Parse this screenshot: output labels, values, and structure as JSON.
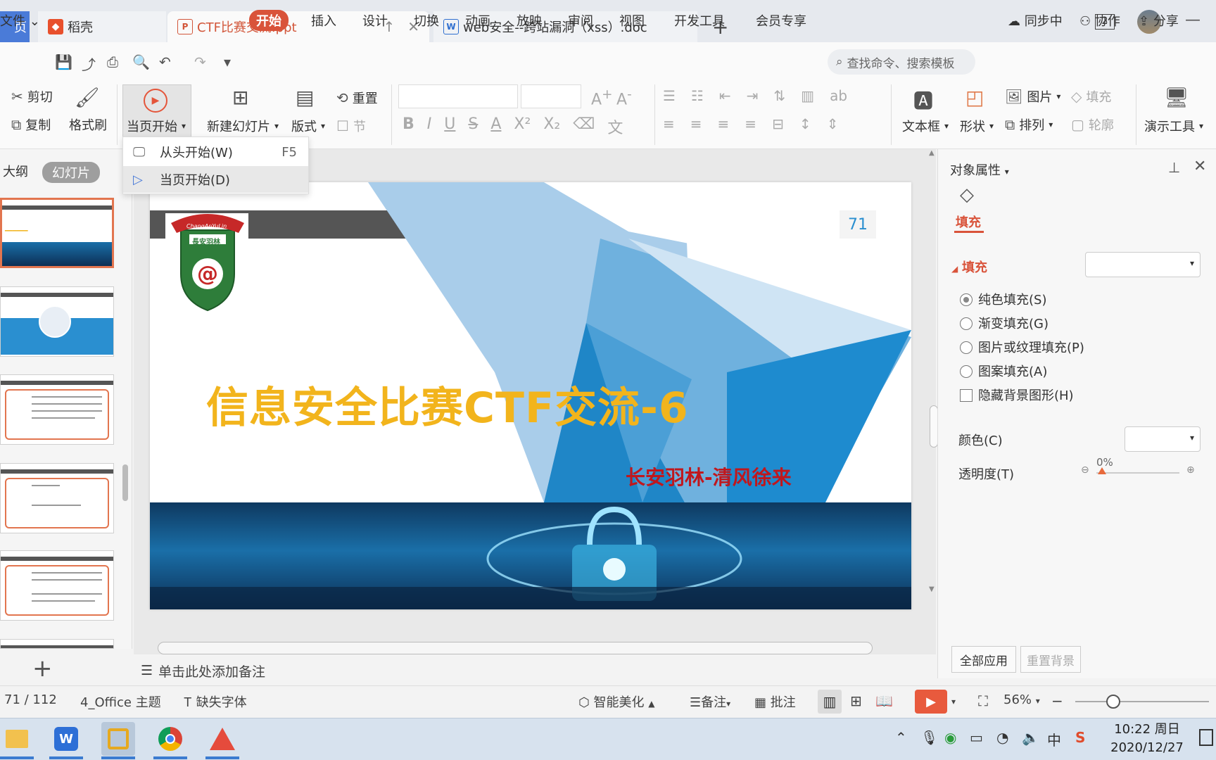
{
  "tabs": {
    "home_label": "页",
    "daoke": "稻壳",
    "active_file": "CTF比赛交流.ppt",
    "doc_file": "web安全--跨站漏洞（xss）.doc",
    "add": "+",
    "window_count": "2"
  },
  "menu": {
    "file": "文件",
    "items": [
      "开始",
      "插入",
      "设计",
      "切换",
      "动画",
      "放映",
      "审阅",
      "视图",
      "开发工具",
      "会员专享"
    ],
    "search_placeholder": "查找命令、搜索模板",
    "sync": "同步中",
    "collab": "协作",
    "share": "分享"
  },
  "ribbon": {
    "cut": "剪切",
    "copy": "复制",
    "format_painter": "格式刷",
    "from_current": "当页开始",
    "new_slide": "新建幻灯片",
    "layout": "版式",
    "reset": "重置",
    "section": "节",
    "textbox": "文本框",
    "shape": "形状",
    "picture": "图片",
    "arrange": "排列",
    "fill": "填充",
    "outline": "轮廓",
    "presenter_tools": "演示工具"
  },
  "dropdown": {
    "from_start": "从头开始(W)",
    "from_start_key": "F5",
    "from_current": "当页开始(D)"
  },
  "left_panel": {
    "outline_tab": "大纲",
    "slides_tab": "幻灯片",
    "add_icon": "+"
  },
  "slide": {
    "number": "71",
    "title": "信息安全比赛CTF交流-6",
    "subtitle": "长安羽林-清风徐来",
    "logo_text": "ChangAnYuLin",
    "logo_cn": "長安羽林"
  },
  "notes_placeholder": "单击此处添加备注",
  "right_panel": {
    "title": "对象属性",
    "tab_fill": "填充",
    "section_fill": "填充",
    "options": [
      "纯色填充(S)",
      "渐变填充(G)",
      "图片或纹理填充(P)",
      "图案填充(A)"
    ],
    "selected_option": 0,
    "hide_bg": "隐藏背景图形(H)",
    "color_label": "颜色(C)",
    "transparency_label": "透明度(T)",
    "transparency_value": "0%",
    "apply_all": "全部应用",
    "reset_bg": "重置背景"
  },
  "status": {
    "slide_pos": "71 / 112",
    "theme": "4_Office 主题",
    "missing_font": "缺失字体",
    "beautify": "智能美化",
    "notes": "备注",
    "comments": "批注",
    "zoom": "56%"
  },
  "taskbar": {
    "time": "10:22 周日",
    "date": "2020/12/27",
    "ime": "中"
  },
  "colors": {
    "accent": "#d9533a",
    "title_yellow": "#f2b41c",
    "subtitle_red": "#c0171d"
  }
}
